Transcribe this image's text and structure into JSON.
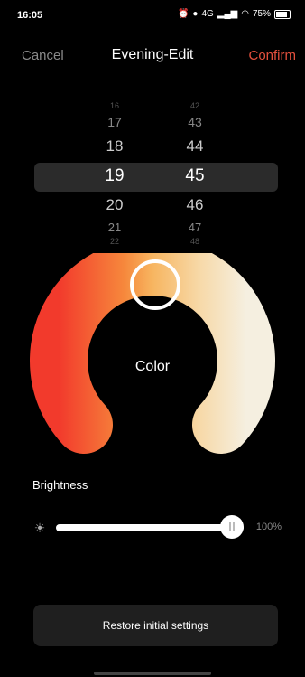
{
  "status_bar": {
    "time": "16:05",
    "battery": "75%",
    "network": "4G"
  },
  "header": {
    "cancel": "Cancel",
    "title": "Evening-Edit",
    "confirm": "Confirm"
  },
  "picker": {
    "hours": [
      "16",
      "17",
      "18",
      "19",
      "20",
      "21",
      "22"
    ],
    "minutes": [
      "42",
      "43",
      "44",
      "45",
      "46",
      "47",
      "48"
    ],
    "selected_hour": "19",
    "selected_minute": "45"
  },
  "color_wheel": {
    "label": "Color"
  },
  "brightness": {
    "label": "Brightness",
    "value_text": "100%",
    "level": 1.0
  },
  "restore_button": {
    "label": "Restore initial settings"
  },
  "colors": {
    "accent": "#e4503d",
    "arc_warm": "#f04a2e",
    "arc_mid": "#f6b05a",
    "arc_cool": "#f4ecd8"
  }
}
